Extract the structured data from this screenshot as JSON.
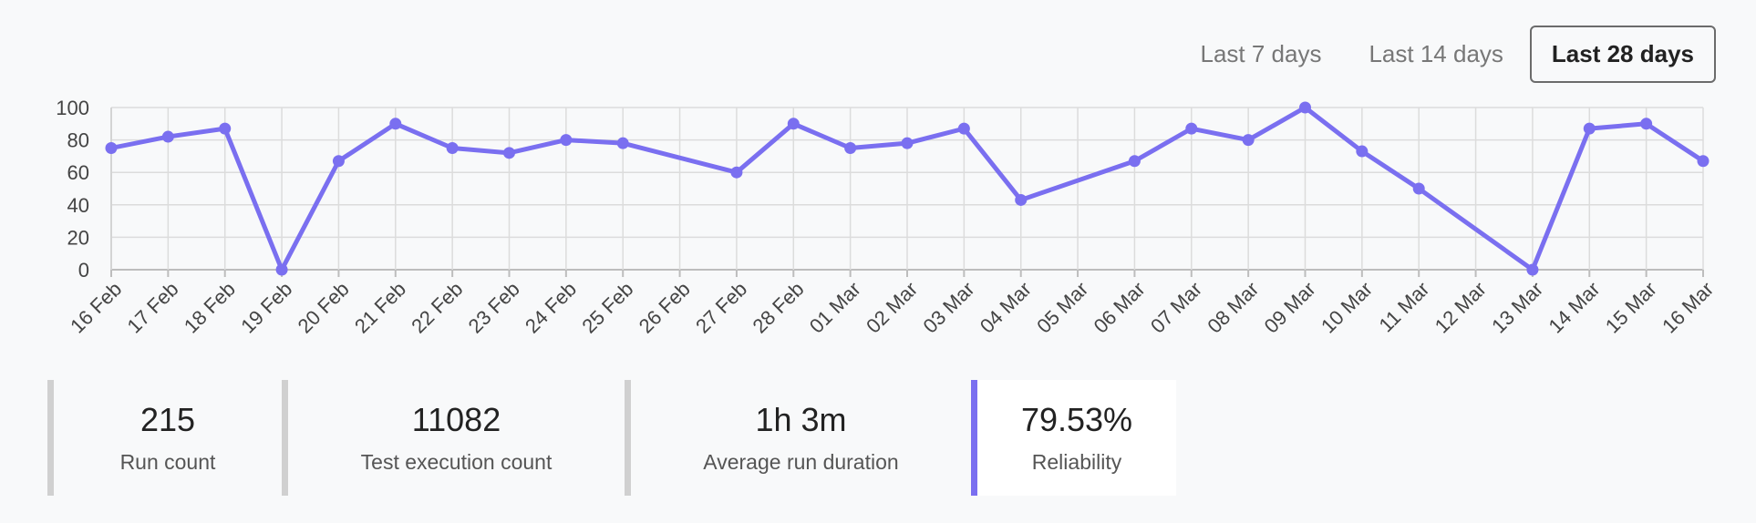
{
  "range_tabs": [
    {
      "label": "Last 7 days",
      "active": false
    },
    {
      "label": "Last 14 days",
      "active": false
    },
    {
      "label": "Last 28 days",
      "active": true
    }
  ],
  "chart_data": {
    "type": "line",
    "x": [
      "16 Feb",
      "17 Feb",
      "18 Feb",
      "19 Feb",
      "20 Feb",
      "21 Feb",
      "22 Feb",
      "23 Feb",
      "24 Feb",
      "25 Feb",
      "26 Feb",
      "27 Feb",
      "28 Feb",
      "01 Mar",
      "02 Mar",
      "03 Mar",
      "04 Mar",
      "05 Mar",
      "06 Mar",
      "07 Mar",
      "08 Mar",
      "09 Mar",
      "10 Mar",
      "11 Mar",
      "12 Mar",
      "13 Mar",
      "14 Mar",
      "15 Mar",
      "16 Mar"
    ],
    "series": [
      {
        "values": [
          75,
          82,
          87,
          0,
          67,
          90,
          75,
          72,
          80,
          78,
          null,
          60,
          90,
          75,
          78,
          87,
          43,
          null,
          67,
          87,
          80,
          100,
          73,
          50,
          null,
          0,
          87,
          90,
          67
        ]
      }
    ],
    "yticks": [
      0,
      20,
      40,
      60,
      80,
      100
    ],
    "ylim": [
      0,
      100
    ],
    "grid": true,
    "line_color": "#7a6ff0"
  },
  "kpis": [
    {
      "value": "215",
      "label": "Run count"
    },
    {
      "value": "11082",
      "label": "Test execution count"
    },
    {
      "value": "1h 3m",
      "label": "Average run duration"
    },
    {
      "value": "79.53%",
      "label": "Reliability"
    }
  ]
}
